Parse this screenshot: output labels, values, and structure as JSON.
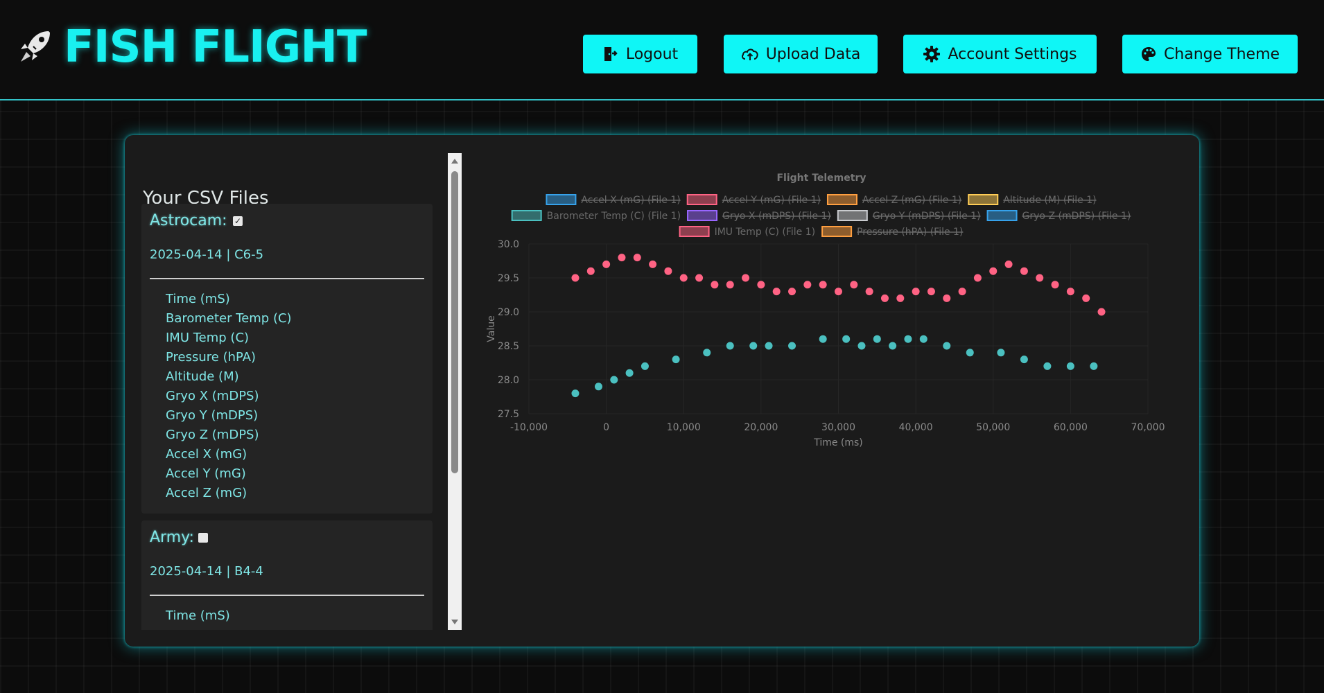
{
  "app": {
    "title": "FISH FLIGHT",
    "logo_icon": "rocket-fish-icon"
  },
  "header": {
    "buttons": [
      {
        "label": "Logout",
        "icon": "logout-door-icon"
      },
      {
        "label": "Upload Data",
        "icon": "cloud-upload-icon"
      },
      {
        "label": "Account Settings",
        "icon": "gear-icon"
      },
      {
        "label": "Change Theme",
        "icon": "palette-icon"
      }
    ]
  },
  "colors": {
    "accent": "#0ff6f6",
    "panel": "#1b1b1b",
    "barometer": "#3fb8b5",
    "imu": "#ee5f7f"
  },
  "sidebar": {
    "title": "Your CSV Files",
    "files": [
      {
        "name": "Astrocam:",
        "checked": true,
        "date": "2025-04-14 | C6-5",
        "columns": [
          "Time (mS)",
          "Barometer Temp (C)",
          "IMU Temp (C)",
          "Pressure (hPA)",
          "Altitude (M)",
          "Gryo X (mDPS)",
          "Gryo Y (mDPS)",
          "Gryo Z (mDPS)",
          "Accel X (mG)",
          "Accel Y (mG)",
          "Accel Z (mG)"
        ]
      },
      {
        "name": "Army:",
        "checked": false,
        "date": "2025-04-14 | B4-4",
        "columns": [
          "Time (mS)"
        ]
      }
    ]
  },
  "chart_data": {
    "type": "scatter",
    "title": "Flight Telemetry",
    "xlabel": "Time (ms)",
    "ylabel": "Value",
    "xlim": [
      -10000,
      70000
    ],
    "ylim": [
      27.5,
      30.0
    ],
    "x_ticks": [
      "-10,000",
      "0",
      "10,000",
      "20,000",
      "30,000",
      "40,000",
      "50,000",
      "60,000",
      "70,000"
    ],
    "y_ticks": [
      "30.0",
      "29.5",
      "29.0",
      "28.5",
      "28.0",
      "27.5"
    ],
    "grid": true,
    "legend_position": "top",
    "legend": [
      {
        "label": "Accel X (mG) (File 1)",
        "color": "#36a2eb",
        "hidden": true
      },
      {
        "label": "Accel Y (mG) (File 1)",
        "color": "#ff6384",
        "hidden": true
      },
      {
        "label": "Accel Z (mG) (File 1)",
        "color": "#ff9f40",
        "hidden": true
      },
      {
        "label": "Altitude (M) (File 1)",
        "color": "#ffcd56",
        "hidden": true
      },
      {
        "label": "Barometer Temp (C) (File 1)",
        "color": "#4bc0c0",
        "hidden": false
      },
      {
        "label": "Gryo X (mDPS) (File 1)",
        "color": "#9966ff",
        "hidden": true
      },
      {
        "label": "Gryo Y (mDPS) (File 1)",
        "color": "#c9cbcf",
        "hidden": true
      },
      {
        "label": "Gryo Z (mDPS) (File 1)",
        "color": "#36a2eb",
        "hidden": true
      },
      {
        "label": "IMU Temp (C) (File 1)",
        "color": "#ff6384",
        "hidden": false
      },
      {
        "label": "Pressure (hPA) (File 1)",
        "color": "#ff9f40",
        "hidden": true
      }
    ],
    "series": [
      {
        "name": "Barometer Temp (C) (File 1)",
        "color": "#4bc0c0",
        "x": [
          -4000,
          -1000,
          1000,
          3000,
          5000,
          9000,
          13000,
          16000,
          19000,
          21000,
          24000,
          28000,
          31000,
          33000,
          35000,
          37000,
          39000,
          41000,
          44000,
          47000,
          51000,
          54000,
          57000,
          60000,
          63000
        ],
        "y": [
          27.8,
          27.9,
          28.0,
          28.1,
          28.2,
          28.3,
          28.4,
          28.5,
          28.5,
          28.5,
          28.5,
          28.6,
          28.6,
          28.5,
          28.6,
          28.5,
          28.6,
          28.6,
          28.5,
          28.4,
          28.4,
          28.3,
          28.2,
          28.2,
          28.2
        ]
      },
      {
        "name": "IMU Temp (C) (File 1)",
        "color": "#ff6384",
        "x": [
          -4000,
          -2000,
          0,
          2000,
          4000,
          6000,
          8000,
          10000,
          12000,
          14000,
          16000,
          18000,
          20000,
          22000,
          24000,
          26000,
          28000,
          30000,
          32000,
          34000,
          36000,
          38000,
          40000,
          42000,
          44000,
          46000,
          48000,
          50000,
          52000,
          54000,
          56000,
          58000,
          60000,
          62000,
          64000
        ],
        "y": [
          29.5,
          29.6,
          29.7,
          29.8,
          29.8,
          29.7,
          29.6,
          29.5,
          29.5,
          29.4,
          29.4,
          29.5,
          29.4,
          29.3,
          29.3,
          29.4,
          29.4,
          29.3,
          29.4,
          29.3,
          29.2,
          29.2,
          29.3,
          29.3,
          29.2,
          29.3,
          29.5,
          29.6,
          29.7,
          29.6,
          29.5,
          29.4,
          29.3,
          29.2,
          29.0
        ]
      }
    ]
  }
}
